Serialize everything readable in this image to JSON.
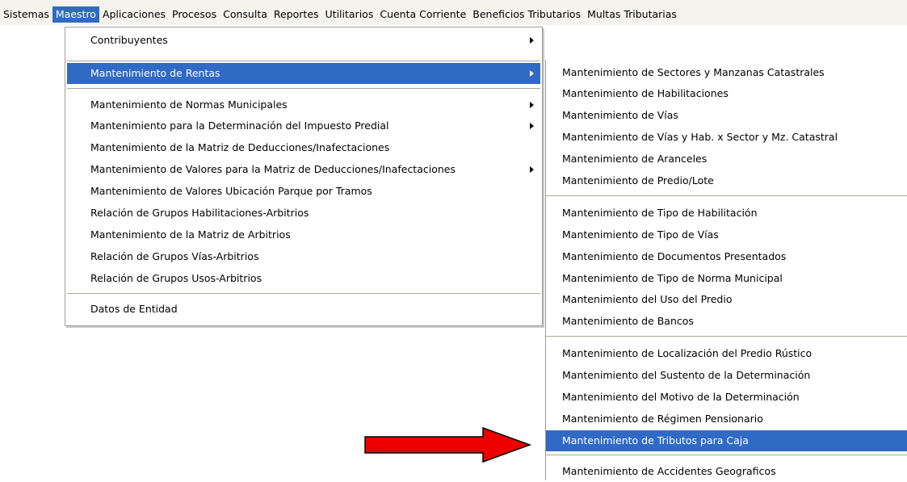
{
  "menubar": {
    "items": [
      {
        "label": "Sistemas"
      },
      {
        "label": "Maestro",
        "active": true
      },
      {
        "label": "Aplicaciones"
      },
      {
        "label": "Procesos"
      },
      {
        "label": "Consulta"
      },
      {
        "label": "Reportes"
      },
      {
        "label": "Utilitarios"
      },
      {
        "label": "Cuenta Corriente"
      },
      {
        "label": "Beneficios Tributarios"
      },
      {
        "label": "Multas Tributarias"
      }
    ]
  },
  "maestro_menu": {
    "items": [
      {
        "label": "Contribuyentes",
        "submenu": true
      },
      {
        "label": "Mantenimiento de Rentas",
        "submenu": true,
        "selected": true
      },
      {
        "label": "Mantenimiento de Normas Municipales",
        "submenu": true
      },
      {
        "label": "Mantenimiento para la Determinación del Impuesto Predial",
        "submenu": true
      },
      {
        "label": "Mantenimiento de la Matriz de Deducciones/Inafectaciones",
        "submenu": false
      },
      {
        "label": "Mantenimiento de Valores para la Matriz de Deducciones/Inafectaciones",
        "submenu": true
      },
      {
        "label": "Mantenimiento de Valores Ubicación Parque por Tramos",
        "submenu": false
      },
      {
        "label": "Relación de Grupos Habilitaciones-Arbitrios",
        "submenu": false
      },
      {
        "label": "Mantenimiento de la Matriz de Arbitrios",
        "submenu": false
      },
      {
        "label": "Relación de Grupos Vías-Arbitrios",
        "submenu": false
      },
      {
        "label": "Relación de Grupos Usos-Arbitrios",
        "submenu": false
      },
      {
        "label": "Datos de Entidad",
        "submenu": false
      }
    ]
  },
  "rentas_submenu": {
    "items": [
      {
        "label": "Mantenimiento de Sectores y Manzanas Catastrales"
      },
      {
        "label": "Mantenimiento de Habilitaciones"
      },
      {
        "label": "Mantenimiento de Vías"
      },
      {
        "label": "Mantenimiento de Vías y Hab. x Sector y Mz. Catastral"
      },
      {
        "label": "Mantenimiento de Aranceles"
      },
      {
        "label": "Mantenimiento de Predio/Lote"
      },
      {
        "label": "Mantenimiento de Tipo de Habilitación"
      },
      {
        "label": "Mantenimiento de Tipo de Vías"
      },
      {
        "label": "Mantenimiento de Documentos Presentados"
      },
      {
        "label": "Mantenimiento de Tipo de Norma Municipal"
      },
      {
        "label": "Mantenimiento del Uso del Predio"
      },
      {
        "label": "Mantenimiento de  Bancos"
      },
      {
        "label": "Mantenimiento de Localización del Predio Rústico"
      },
      {
        "label": "Mantenimiento del Sustento de la Determinación"
      },
      {
        "label": "Mantenimiento del Motivo de la Determinación"
      },
      {
        "label": "Mantenimiento de Régimen Pensionario"
      },
      {
        "label": "Mantenimiento de Tributos para Caja",
        "selected": true
      },
      {
        "label": "Mantenimiento de Accidentes Geograficos"
      }
    ]
  },
  "colors": {
    "selection": "#316ac5",
    "menubar_bg": "#f4f3ee",
    "annotation_arrow_fill": "#ee0000"
  },
  "annotation": {
    "icon": "red-arrow-icon"
  }
}
